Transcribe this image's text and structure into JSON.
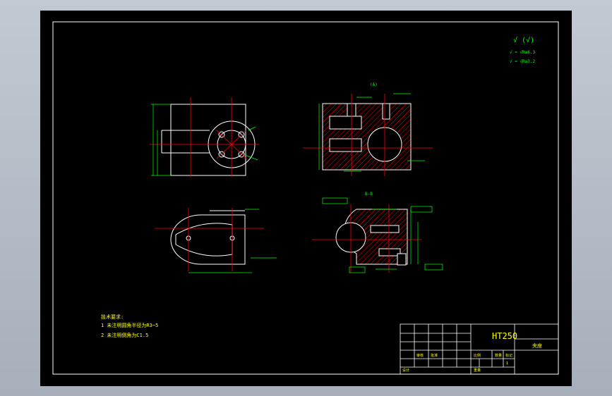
{
  "drawing": {
    "material": "HT250",
    "part_name": "夹座",
    "section_label_top": "(A)",
    "section_label_bottom": "B-B",
    "roughness_symbol_top": "√ (√)",
    "roughness_legend_1": "√ = √Ra6.3",
    "roughness_legend_2": "√ = √Ra3.2",
    "tech_title": "技术要求:",
    "tech_line_1": "1 未注明圆角半径为R3~5",
    "tech_line_2": "2 未注明倒角为C1.5"
  },
  "title_block": {
    "label_scale": "比例",
    "label_qty": "数量",
    "label_mark": "标记",
    "label_weight": "重量",
    "label_design": "设计",
    "label_check": "审核",
    "label_approve": "批准",
    "sheet_num": "1"
  },
  "colors": {
    "sheet": "#000000",
    "outline": "#ffffff",
    "centerline": "#ff0000",
    "dimension": "#00ff00",
    "hatch": "#ff0000",
    "text_yellow": "#ffff00"
  }
}
